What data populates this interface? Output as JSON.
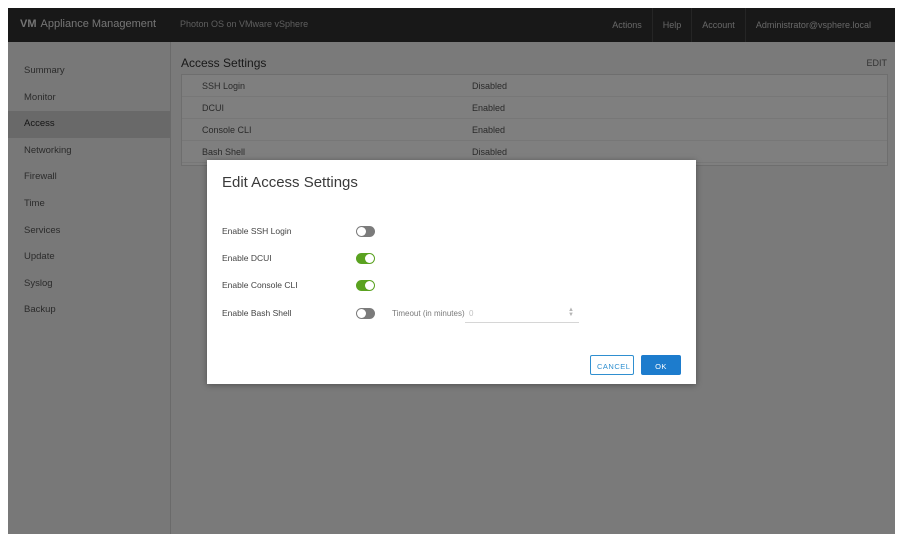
{
  "header": {
    "brand_prefix": "VM",
    "brand_title": "Appliance Management",
    "subtitle": "Photon OS on VMware vSphere",
    "items": [
      "Actions",
      "Help",
      "Account",
      "Administrator@vsphere.local"
    ]
  },
  "sidebar": {
    "items": [
      {
        "label": "Summary",
        "active": false
      },
      {
        "label": "Monitor",
        "active": false
      },
      {
        "label": "Access",
        "active": true
      },
      {
        "label": "Networking",
        "active": false
      },
      {
        "label": "Firewall",
        "active": false
      },
      {
        "label": "Time",
        "active": false
      },
      {
        "label": "Services",
        "active": false
      },
      {
        "label": "Update",
        "active": false
      },
      {
        "label": "Syslog",
        "active": false
      },
      {
        "label": "Backup",
        "active": false
      }
    ]
  },
  "main": {
    "title": "Access Settings",
    "action": "EDIT",
    "rows": [
      {
        "label": "SSH Login",
        "value": "Disabled"
      },
      {
        "label": "DCUI",
        "value": "Enabled"
      },
      {
        "label": "Console CLI",
        "value": "Enabled"
      },
      {
        "label": "Bash Shell",
        "value": "Disabled"
      }
    ]
  },
  "modal": {
    "title": "Edit Access Settings",
    "rows": [
      {
        "label": "Enable SSH Login",
        "on": false
      },
      {
        "label": "Enable DCUI",
        "on": true
      },
      {
        "label": "Enable Console CLI",
        "on": true
      },
      {
        "label": "Enable Bash Shell",
        "on": false
      }
    ],
    "timeout_label": "Timeout (in minutes)",
    "timeout_value": "0",
    "cancel_label": "CANCEL",
    "ok_label": "OK"
  },
  "colors": {
    "toggle_on": "#5aa220",
    "toggle_off": "#7b7b7b",
    "primary": "#1d7ccd",
    "header_bg": "#313131"
  }
}
